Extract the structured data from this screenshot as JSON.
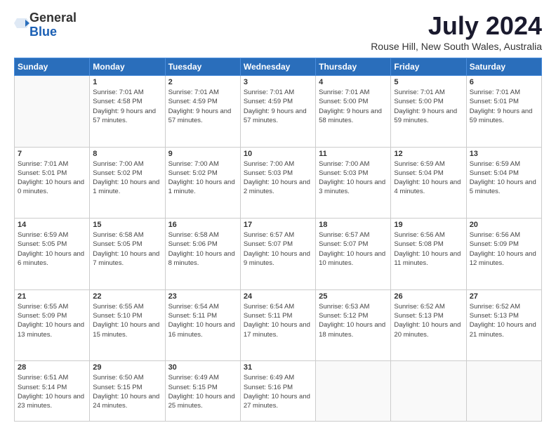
{
  "logo": {
    "general": "General",
    "blue": "Blue"
  },
  "title": "July 2024",
  "subtitle": "Rouse Hill, New South Wales, Australia",
  "days": [
    "Sunday",
    "Monday",
    "Tuesday",
    "Wednesday",
    "Thursday",
    "Friday",
    "Saturday"
  ],
  "weeks": [
    [
      {
        "date": "",
        "sunrise": "",
        "sunset": "",
        "daylight": ""
      },
      {
        "date": "1",
        "sunrise": "7:01 AM",
        "sunset": "4:58 PM",
        "daylight": "9 hours and 57 minutes."
      },
      {
        "date": "2",
        "sunrise": "7:01 AM",
        "sunset": "4:59 PM",
        "daylight": "9 hours and 57 minutes."
      },
      {
        "date": "3",
        "sunrise": "7:01 AM",
        "sunset": "4:59 PM",
        "daylight": "9 hours and 57 minutes."
      },
      {
        "date": "4",
        "sunrise": "7:01 AM",
        "sunset": "5:00 PM",
        "daylight": "9 hours and 58 minutes."
      },
      {
        "date": "5",
        "sunrise": "7:01 AM",
        "sunset": "5:00 PM",
        "daylight": "9 hours and 59 minutes."
      },
      {
        "date": "6",
        "sunrise": "7:01 AM",
        "sunset": "5:01 PM",
        "daylight": "9 hours and 59 minutes."
      }
    ],
    [
      {
        "date": "7",
        "sunrise": "7:01 AM",
        "sunset": "5:01 PM",
        "daylight": "10 hours and 0 minutes."
      },
      {
        "date": "8",
        "sunrise": "7:00 AM",
        "sunset": "5:02 PM",
        "daylight": "10 hours and 1 minute."
      },
      {
        "date": "9",
        "sunrise": "7:00 AM",
        "sunset": "5:02 PM",
        "daylight": "10 hours and 1 minute."
      },
      {
        "date": "10",
        "sunrise": "7:00 AM",
        "sunset": "5:03 PM",
        "daylight": "10 hours and 2 minutes."
      },
      {
        "date": "11",
        "sunrise": "7:00 AM",
        "sunset": "5:03 PM",
        "daylight": "10 hours and 3 minutes."
      },
      {
        "date": "12",
        "sunrise": "6:59 AM",
        "sunset": "5:04 PM",
        "daylight": "10 hours and 4 minutes."
      },
      {
        "date": "13",
        "sunrise": "6:59 AM",
        "sunset": "5:04 PM",
        "daylight": "10 hours and 5 minutes."
      }
    ],
    [
      {
        "date": "14",
        "sunrise": "6:59 AM",
        "sunset": "5:05 PM",
        "daylight": "10 hours and 6 minutes."
      },
      {
        "date": "15",
        "sunrise": "6:58 AM",
        "sunset": "5:05 PM",
        "daylight": "10 hours and 7 minutes."
      },
      {
        "date": "16",
        "sunrise": "6:58 AM",
        "sunset": "5:06 PM",
        "daylight": "10 hours and 8 minutes."
      },
      {
        "date": "17",
        "sunrise": "6:57 AM",
        "sunset": "5:07 PM",
        "daylight": "10 hours and 9 minutes."
      },
      {
        "date": "18",
        "sunrise": "6:57 AM",
        "sunset": "5:07 PM",
        "daylight": "10 hours and 10 minutes."
      },
      {
        "date": "19",
        "sunrise": "6:56 AM",
        "sunset": "5:08 PM",
        "daylight": "10 hours and 11 minutes."
      },
      {
        "date": "20",
        "sunrise": "6:56 AM",
        "sunset": "5:09 PM",
        "daylight": "10 hours and 12 minutes."
      }
    ],
    [
      {
        "date": "21",
        "sunrise": "6:55 AM",
        "sunset": "5:09 PM",
        "daylight": "10 hours and 13 minutes."
      },
      {
        "date": "22",
        "sunrise": "6:55 AM",
        "sunset": "5:10 PM",
        "daylight": "10 hours and 15 minutes."
      },
      {
        "date": "23",
        "sunrise": "6:54 AM",
        "sunset": "5:11 PM",
        "daylight": "10 hours and 16 minutes."
      },
      {
        "date": "24",
        "sunrise": "6:54 AM",
        "sunset": "5:11 PM",
        "daylight": "10 hours and 17 minutes."
      },
      {
        "date": "25",
        "sunrise": "6:53 AM",
        "sunset": "5:12 PM",
        "daylight": "10 hours and 18 minutes."
      },
      {
        "date": "26",
        "sunrise": "6:52 AM",
        "sunset": "5:13 PM",
        "daylight": "10 hours and 20 minutes."
      },
      {
        "date": "27",
        "sunrise": "6:52 AM",
        "sunset": "5:13 PM",
        "daylight": "10 hours and 21 minutes."
      }
    ],
    [
      {
        "date": "28",
        "sunrise": "6:51 AM",
        "sunset": "5:14 PM",
        "daylight": "10 hours and 23 minutes."
      },
      {
        "date": "29",
        "sunrise": "6:50 AM",
        "sunset": "5:15 PM",
        "daylight": "10 hours and 24 minutes."
      },
      {
        "date": "30",
        "sunrise": "6:49 AM",
        "sunset": "5:15 PM",
        "daylight": "10 hours and 25 minutes."
      },
      {
        "date": "31",
        "sunrise": "6:49 AM",
        "sunset": "5:16 PM",
        "daylight": "10 hours and 27 minutes."
      },
      {
        "date": "",
        "sunrise": "",
        "sunset": "",
        "daylight": ""
      },
      {
        "date": "",
        "sunrise": "",
        "sunset": "",
        "daylight": ""
      },
      {
        "date": "",
        "sunrise": "",
        "sunset": "",
        "daylight": ""
      }
    ]
  ]
}
